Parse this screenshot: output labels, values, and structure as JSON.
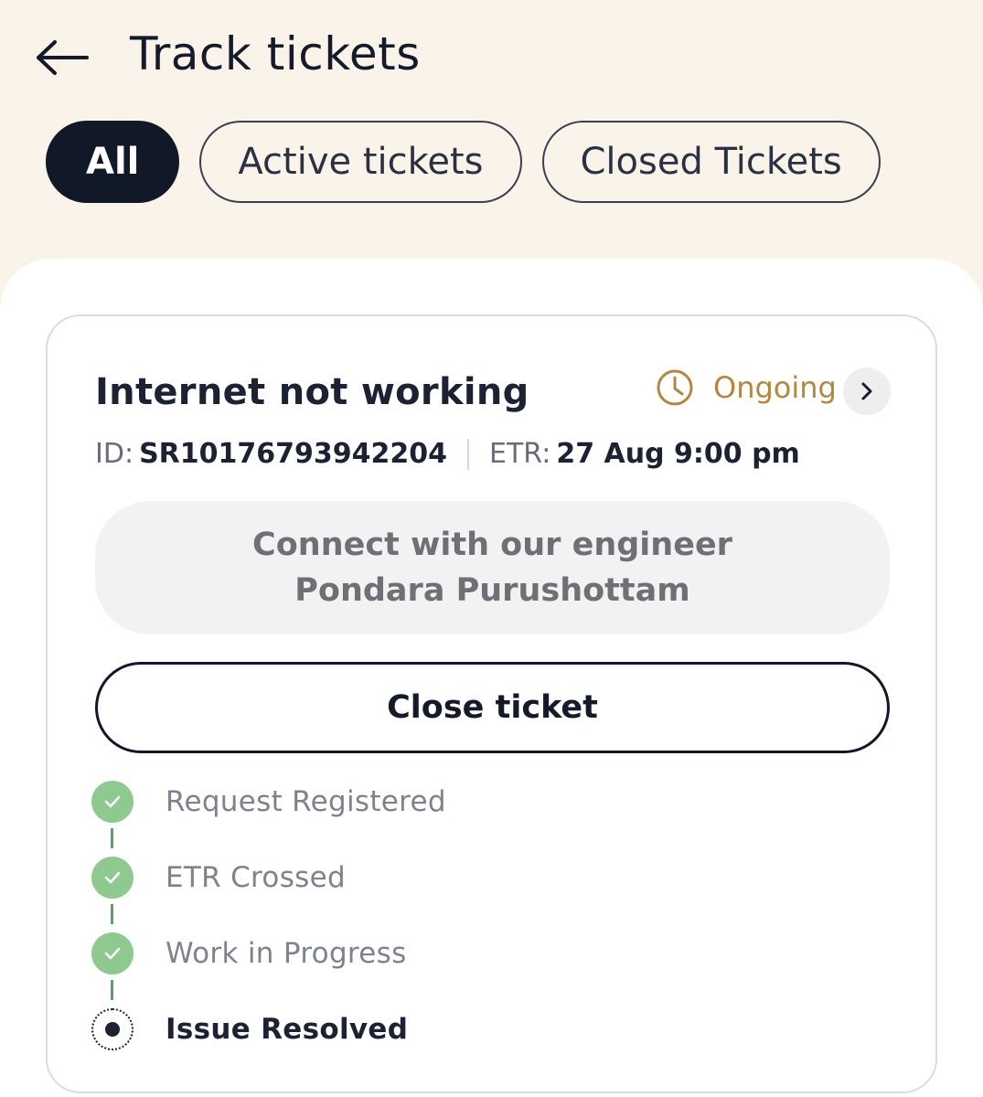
{
  "header": {
    "title": "Track tickets",
    "back_icon": "arrow-left-icon"
  },
  "filters": [
    {
      "label": "All",
      "active": true
    },
    {
      "label": "Active tickets",
      "active": false
    },
    {
      "label": "Closed Tickets",
      "active": false
    }
  ],
  "ticket": {
    "title": "Internet not working",
    "status": "Ongoing",
    "status_icon": "clock-icon",
    "status_color": "#b5863f",
    "id_label": "ID:",
    "id_value": "SR10176793942204",
    "etr_label": "ETR:",
    "etr_value": "27 Aug 9:00 pm",
    "connect_text": "Connect with our engineer Pondara Purushottam",
    "close_button": "Close ticket",
    "steps": [
      {
        "label": "Request Registered",
        "state": "done"
      },
      {
        "label": "ETR Crossed",
        "state": "done"
      },
      {
        "label": "Work in Progress",
        "state": "done"
      },
      {
        "label": "Issue Resolved",
        "state": "current"
      }
    ]
  },
  "colors": {
    "background": "#faf3ea",
    "accent_dark": "#111827",
    "step_done": "#8ec98f",
    "connector": "#5aa45d"
  }
}
